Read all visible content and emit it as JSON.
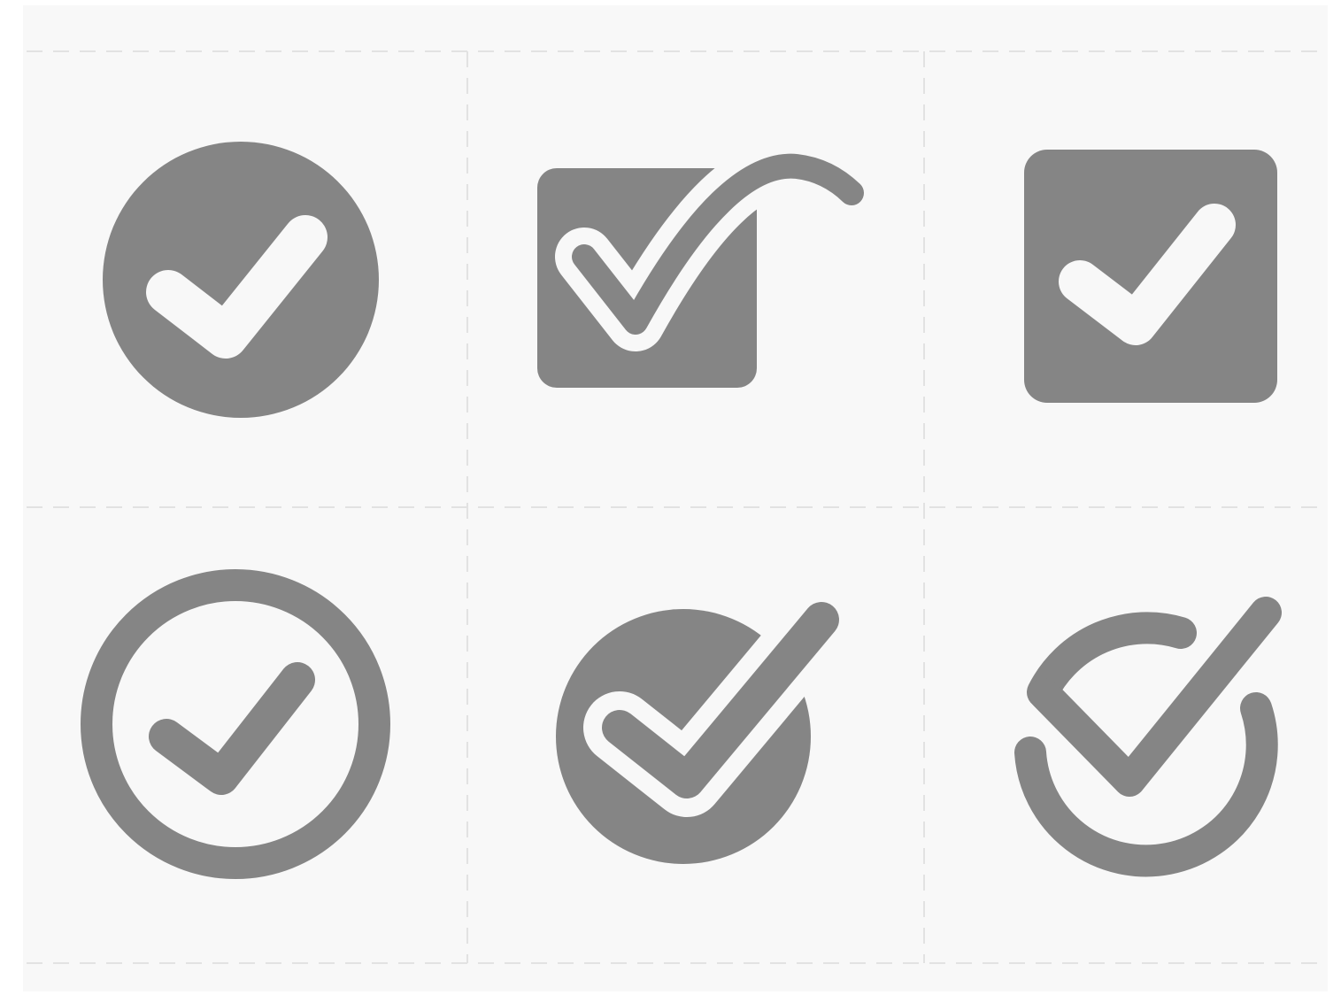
{
  "colors": {
    "background": "#f8f8f8",
    "icon_fill": "#858585",
    "cutout": "#f8f8f8",
    "grid_line": "#e2e2e2"
  },
  "icons": [
    {
      "name": "filled-circle-check-icon"
    },
    {
      "name": "square-swoosh-check-icon"
    },
    {
      "name": "filled-rounded-square-check-icon"
    },
    {
      "name": "outline-circle-check-icon"
    },
    {
      "name": "circle-overflow-check-icon"
    },
    {
      "name": "open-circle-check-icon"
    }
  ]
}
